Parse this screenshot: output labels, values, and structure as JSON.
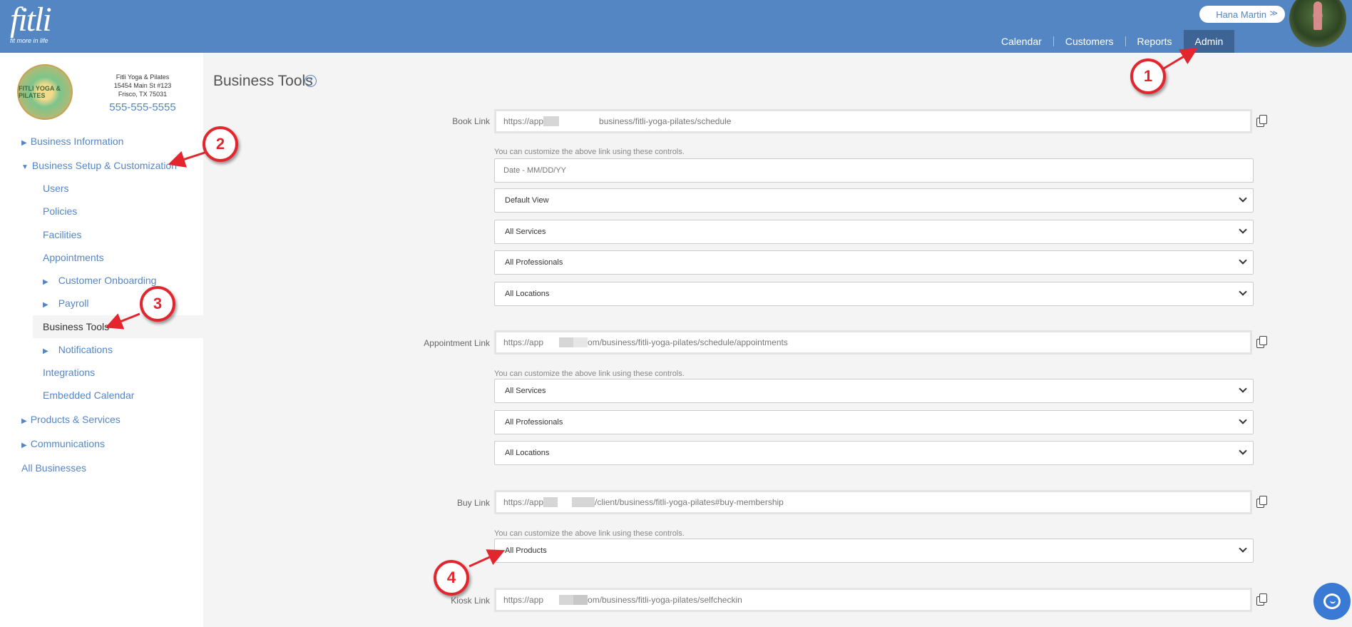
{
  "header": {
    "logo_text": "fitli",
    "logo_tagline": "fit more in life",
    "user_name": "Hana Martin",
    "user_chevron": "≫",
    "nav": [
      {
        "label": "Calendar"
      },
      {
        "label": "Customers"
      },
      {
        "label": "Reports"
      },
      {
        "label": "Admin",
        "active": true
      }
    ]
  },
  "business": {
    "logo_text": "FITLI YOGA & PILATES",
    "name": "Fitli Yoga & Pilates",
    "address1": "15454 Main St #123",
    "address2": "Frisco, TX 75031",
    "phone": "555-555-5555"
  },
  "sidebar": {
    "business_information": "Business Information",
    "business_setup": "Business Setup & Customization",
    "users": "Users",
    "policies": "Policies",
    "facilities": "Facilities",
    "appointments": "Appointments",
    "customer_onboarding": "Customer Onboarding",
    "payroll": "Payroll",
    "business_tools": "Business Tools",
    "notifications": "Notifications",
    "integrations": "Integrations",
    "embedded_calendar": "Embedded Calendar",
    "products_services": "Products & Services",
    "communications": "Communications",
    "all_businesses": "All Businesses"
  },
  "main": {
    "title": "Business Tools",
    "help": "?",
    "hint": "You can customize the above link using these controls.",
    "book": {
      "label": "Book Link",
      "url_start": "https://app",
      "url_end": "business/fitli-yoga-pilates/schedule",
      "date_placeholder": "Date - MM/DD/YY",
      "view": "Default View",
      "services": "All Services",
      "professionals": "All Professionals",
      "locations": "All Locations"
    },
    "appointment": {
      "label": "Appointment Link",
      "url_start": "https://app",
      "url_end": "om/business/fitli-yoga-pilates/schedule/appointments",
      "services": "All Services",
      "professionals": "All Professionals",
      "locations": "All Locations"
    },
    "buy": {
      "label": "Buy Link",
      "url_start": "https://app",
      "url_end": "/client/business/fitli-yoga-pilates#buy-membership",
      "products": "All Products"
    },
    "kiosk": {
      "label": "Kiosk Link",
      "url_start": "https://app",
      "url_end": "om/business/fitli-yoga-pilates/selfcheckin"
    }
  },
  "annotations": [
    "1",
    "2",
    "3",
    "4"
  ],
  "colors": {
    "header": "#5586c4",
    "nav_active": "#3e6496",
    "link": "#5586c4",
    "annotation": "#e3262e",
    "chat": "#3a7ad5"
  }
}
